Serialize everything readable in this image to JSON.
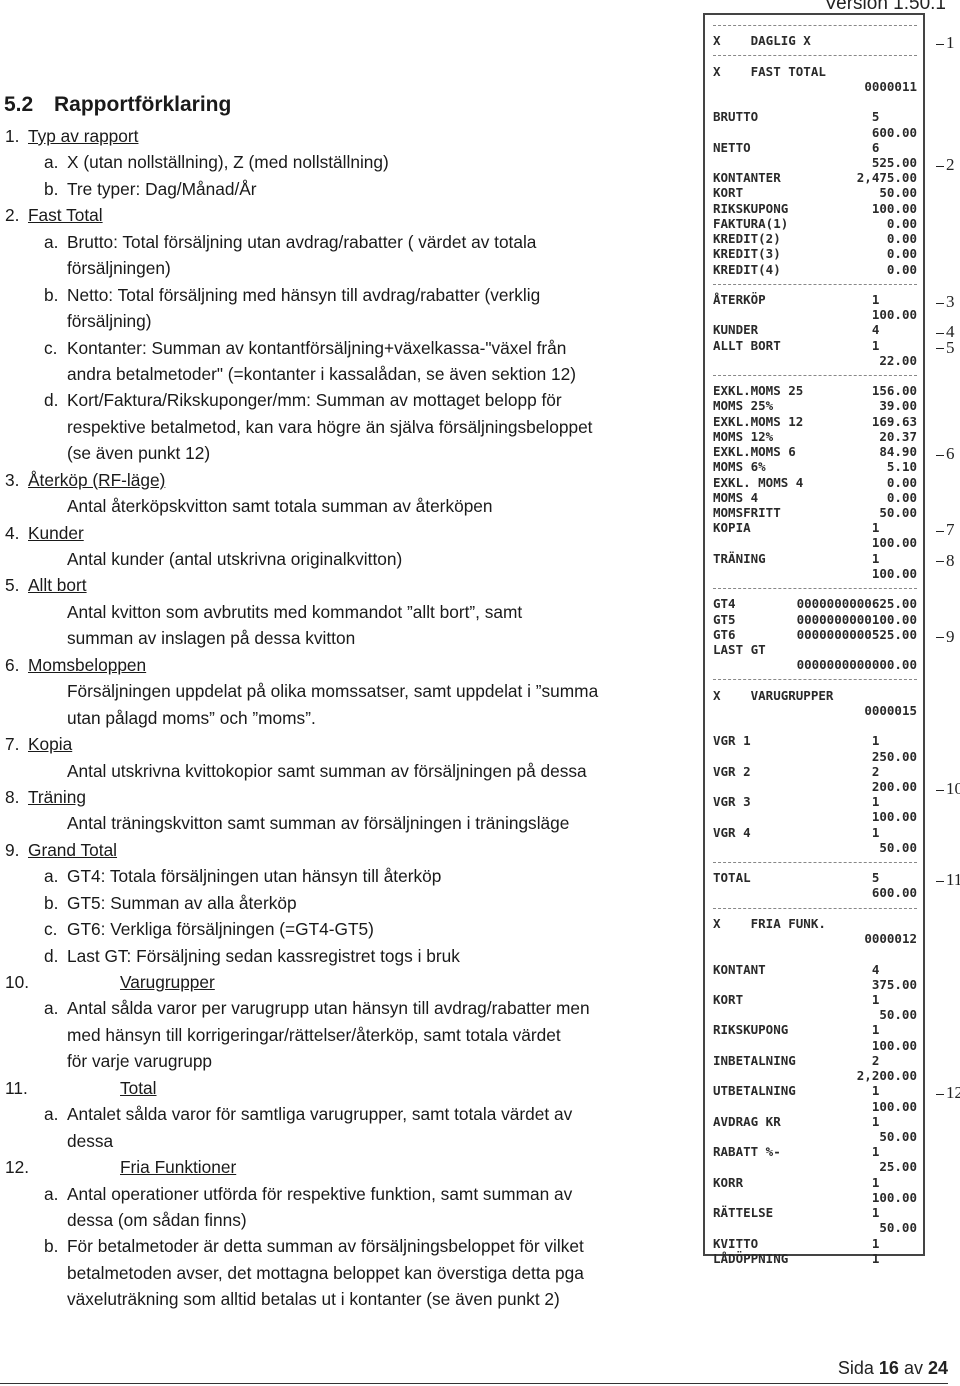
{
  "header": {
    "version": "Version 1.50.1"
  },
  "section": {
    "number": "5.2",
    "title": "Rapportförklaring"
  },
  "lines": [
    {
      "n": "1.",
      "t": "Typ av rapport",
      "u": true
    },
    {
      "n": "a.",
      "t": "X (utan nollställning), Z (med nollställning)",
      "lvl": 1
    },
    {
      "n": "b.",
      "t": "Tre typer: Dag/Månad/År",
      "lvl": 1
    },
    {
      "n": "2.",
      "t": "Fast Total",
      "u": true
    },
    {
      "n": "a.",
      "t": "Brutto: Total försäljning utan avdrag/rabatter ( värdet  av totala",
      "lvl": 1
    },
    {
      "n": "",
      "t": "försäljningen)",
      "lvl": 1
    },
    {
      "n": "b.",
      "t": "Netto: Total försäljning med hänsyn till avdrag/rabatter (verklig",
      "lvl": 1
    },
    {
      "n": "",
      "t": "försäljning)",
      "lvl": 1
    },
    {
      "n": "c.",
      "t": "Kontanter: Summan av kontantförsäljning+växelkassa-\"växel från",
      "lvl": 1
    },
    {
      "n": "",
      "t": "andra betalmetoder\" (=kontanter i kassalådan, se även sektion 12)",
      "lvl": 1
    },
    {
      "n": "d.",
      "t": "Kort/Faktura/Rikskuponger/mm: Summan av mottaget belopp för",
      "lvl": 1
    },
    {
      "n": "",
      "t": "respektive betalmetod, kan vara högre än själva försäljningsbeloppet",
      "lvl": 1
    },
    {
      "n": "",
      "t": "(se även punkt 12)",
      "lvl": 1
    },
    {
      "n": "3.",
      "t": "Återköp (RF-läge)",
      "u": true
    },
    {
      "n": "",
      "t": "Antal återköpskvitton samt totala summan av återköpen",
      "lvl": 1
    },
    {
      "n": "4.",
      "t": "Kunder",
      "u": true
    },
    {
      "n": "",
      "t": "Antal kunder (antal utskrivna originalkvitton)",
      "lvl": 1
    },
    {
      "n": "5.",
      "t": "Allt bort",
      "u": true
    },
    {
      "n": "",
      "t": "Antal kvitton som avbrutits med kommandot ”allt bort”, samt",
      "lvl": 1
    },
    {
      "n": "",
      "t": "summan av inslagen på dessa kvitton",
      "lvl": 1
    },
    {
      "n": "6.",
      "t": "Momsbeloppen",
      "u": true
    },
    {
      "n": "",
      "t": "Försäljningen uppdelat på olika momssatser, samt uppdelat i ”summa",
      "lvl": 1
    },
    {
      "n": "",
      "t": "utan pålagd moms” och ”moms”.",
      "lvl": 1
    },
    {
      "n": "7.",
      "t": "Kopia",
      "u": true
    },
    {
      "n": "",
      "t": "Antal utskrivna kvittokopior samt summan av försäljningen på dessa",
      "lvl": 1
    },
    {
      "n": "8.",
      "t": "Träning",
      "u": true
    },
    {
      "n": "",
      "t": "Antal träningskvitton samt summan av försäljningen i träningsläge",
      "lvl": 1
    },
    {
      "n": "9.",
      "t": "Grand Total",
      "u": true
    },
    {
      "n": "a.",
      "t": "GT4: Totala försäljningen utan hänsyn till återköp",
      "lvl": 1
    },
    {
      "n": "b.",
      "t": "GT5: Summan av alla återköp",
      "lvl": 1
    },
    {
      "n": "c.",
      "t": "GT6: Verkliga försäljningen (=GT4-GT5)",
      "lvl": 1
    },
    {
      "n": "d.",
      "t": "Last GT: Försäljning sedan kassregistret togs i bruk",
      "lvl": 1
    },
    {
      "n": "10.",
      "t": "Varugrupper",
      "u": true,
      "wide": true
    },
    {
      "n": "a.",
      "t": "Antal sålda varor per varugrupp utan hänsyn till avdrag/rabatter men",
      "lvl": 1
    },
    {
      "n": "",
      "t": "med hänsyn till korrigeringar/rättelser/återköp, samt totala värdet",
      "lvl": 1
    },
    {
      "n": "",
      "t": "för varje varugrupp",
      "lvl": 1
    },
    {
      "n": "11.",
      "t": "Total",
      "u": true,
      "wide": true
    },
    {
      "n": "a.",
      "t": "Antalet sålda varor för samtliga varugrupper, samt totala värdet av",
      "lvl": 1
    },
    {
      "n": "",
      "t": "dessa",
      "lvl": 1
    },
    {
      "n": "12.",
      "t": "Fria Funktioner",
      "u": true,
      "wide": true
    },
    {
      "n": "a.",
      "t": "Antal operationer utförda för respektive funktion, samt summan av",
      "lvl": 1
    },
    {
      "n": "",
      "t": "dessa (om sådan finns)",
      "lvl": 1
    },
    {
      "n": "b.",
      "t": "För betalmetoder är detta summan av försäljningsbeloppet för vilket",
      "lvl": 1
    },
    {
      "n": "",
      "t": "betalmetoden avser, det mottagna beloppet kan överstiga detta pga",
      "lvl": 1
    },
    {
      "n": "",
      "t": "växeluträkning som alltid betalas ut i kontanter (se även punkt 2)",
      "lvl": 1
    }
  ],
  "receipt": [
    {
      "sep": true
    },
    {
      "l": "X    DAGLIG X",
      "m": "1"
    },
    {
      "sep": true
    },
    {
      "l": "X    FAST TOTAL"
    },
    {
      "v": "0000011"
    },
    {},
    {
      "l": "BRUTTO",
      "v": "5     "
    },
    {
      "v": "600.00"
    },
    {
      "l": "NETTO",
      "v": "6     "
    },
    {
      "v": "525.00",
      "m": "2"
    },
    {
      "l": "KONTANTER",
      "v": "2,475.00"
    },
    {
      "l": "KORT",
      "v": "50.00"
    },
    {
      "l": "RIKSKUPONG",
      "v": "100.00"
    },
    {
      "l": "FAKTURA(1)",
      "v": "0.00"
    },
    {
      "l": "KREDIT(2)",
      "v": "0.00"
    },
    {
      "l": "KREDIT(3)",
      "v": "0.00"
    },
    {
      "l": "KREDIT(4)",
      "v": "0.00"
    },
    {
      "sep": true
    },
    {
      "l": "ÅTERKÖP",
      "v": "1     ",
      "m": "3"
    },
    {
      "v": "100.00"
    },
    {
      "l": "KUNDER",
      "v": "4     ",
      "m": "4"
    },
    {
      "l": "ALLT BORT",
      "v": "1     ",
      "m": "5"
    },
    {
      "v": "22.00"
    },
    {
      "sep": true
    },
    {
      "l": "EXKL.MOMS 25",
      "v": "156.00"
    },
    {
      "l": "MOMS 25%",
      "v": "39.00"
    },
    {
      "l": "EXKL.MOMS 12",
      "v": "169.63"
    },
    {
      "l": "MOMS 12%",
      "v": "20.37"
    },
    {
      "l": "EXKL.MOMS 6",
      "v": "84.90",
      "m": "6"
    },
    {
      "l": "MOMS 6%",
      "v": "5.10"
    },
    {
      "l": "EXKL. MOMS 4",
      "v": "0.00"
    },
    {
      "l": "MOMS 4",
      "v": "0.00"
    },
    {
      "l": "MOMSFRITT",
      "v": "50.00"
    },
    {
      "l": "KOPIA",
      "v": "1     ",
      "m": "7"
    },
    {
      "v": "100.00"
    },
    {
      "l": "TRÄNING",
      "v": "1     ",
      "m": "8"
    },
    {
      "v": "100.00"
    },
    {
      "sep": true
    },
    {
      "l": "GT4",
      "v": "0000000000625.00"
    },
    {
      "l": "GT5",
      "v": "0000000000100.00"
    },
    {
      "l": "GT6",
      "v": "0000000000525.00",
      "m": "9"
    },
    {
      "l": "LAST GT"
    },
    {
      "v": "0000000000000.00"
    },
    {
      "sep": true
    },
    {
      "l": "X    VARUGRUPPER"
    },
    {
      "v": "0000015"
    },
    {},
    {
      "l": "VGR 1",
      "v": "1     "
    },
    {
      "v": "250.00"
    },
    {
      "l": "VGR 2",
      "v": "2     "
    },
    {
      "v": "200.00",
      "m": "10"
    },
    {
      "l": "VGR 3",
      "v": "1     "
    },
    {
      "v": "100.00"
    },
    {
      "l": "VGR 4",
      "v": "1     "
    },
    {
      "v": "50.00"
    },
    {
      "sep": true
    },
    {
      "l": "TOTAL",
      "v": "5     ",
      "m": "11"
    },
    {
      "v": "600.00"
    },
    {
      "sep": true
    },
    {
      "l": "X    FRIA FUNK."
    },
    {
      "v": "0000012"
    },
    {},
    {
      "l": "KONTANT",
      "v": "4     "
    },
    {
      "v": "375.00"
    },
    {
      "l": "KORT",
      "v": "1     "
    },
    {
      "v": "50.00"
    },
    {
      "l": "RIKSKUPONG",
      "v": "1     "
    },
    {
      "v": "100.00"
    },
    {
      "l": "INBETALNING",
      "v": "2     "
    },
    {
      "v": "2,200.00"
    },
    {
      "l": "UTBETALNING",
      "v": "1     ",
      "m": "12"
    },
    {
      "v": "100.00"
    },
    {
      "l": "AVDRAG KR",
      "v": "1     "
    },
    {
      "v": "50.00"
    },
    {
      "l": "RABATT %-",
      "v": "1     "
    },
    {
      "v": "25.00"
    },
    {
      "l": "KORR",
      "v": "1     "
    },
    {
      "v": "100.00"
    },
    {
      "l": "RÄTTELSE",
      "v": "1     "
    },
    {
      "v": "50.00"
    },
    {
      "l": "KVITTO",
      "v": "1     "
    },
    {
      "l": "LÅDÖPPNING",
      "v": "1     "
    }
  ],
  "footer": {
    "prefix": "Sida",
    "page": "16",
    "sep": "av",
    "total": "24"
  }
}
